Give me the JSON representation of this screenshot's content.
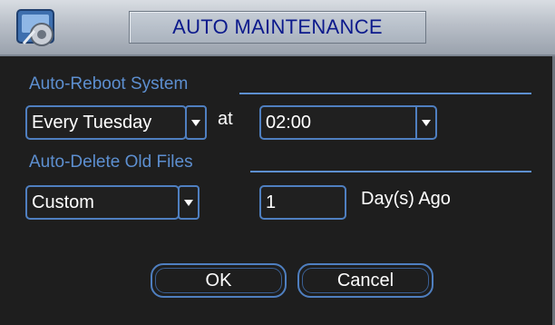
{
  "dialog": {
    "title": "AUTO MAINTENANCE",
    "icon": "app-maintenance-icon"
  },
  "auto_reboot": {
    "section_label": "Auto-Reboot System",
    "day_value": "Every Tuesday",
    "at_label": "at",
    "time_value": "02:00"
  },
  "auto_delete": {
    "section_label": "Auto-Delete Old Files",
    "mode_value": "Custom",
    "days_value": "1",
    "days_suffix": "Day(s) Ago"
  },
  "buttons": {
    "ok_label": "OK",
    "cancel_label": "Cancel"
  },
  "colors": {
    "title_text": "#0c1a8c",
    "section_label": "#5d8fd0",
    "field_border": "#4f7fc0",
    "background": "#1e1e1e"
  }
}
